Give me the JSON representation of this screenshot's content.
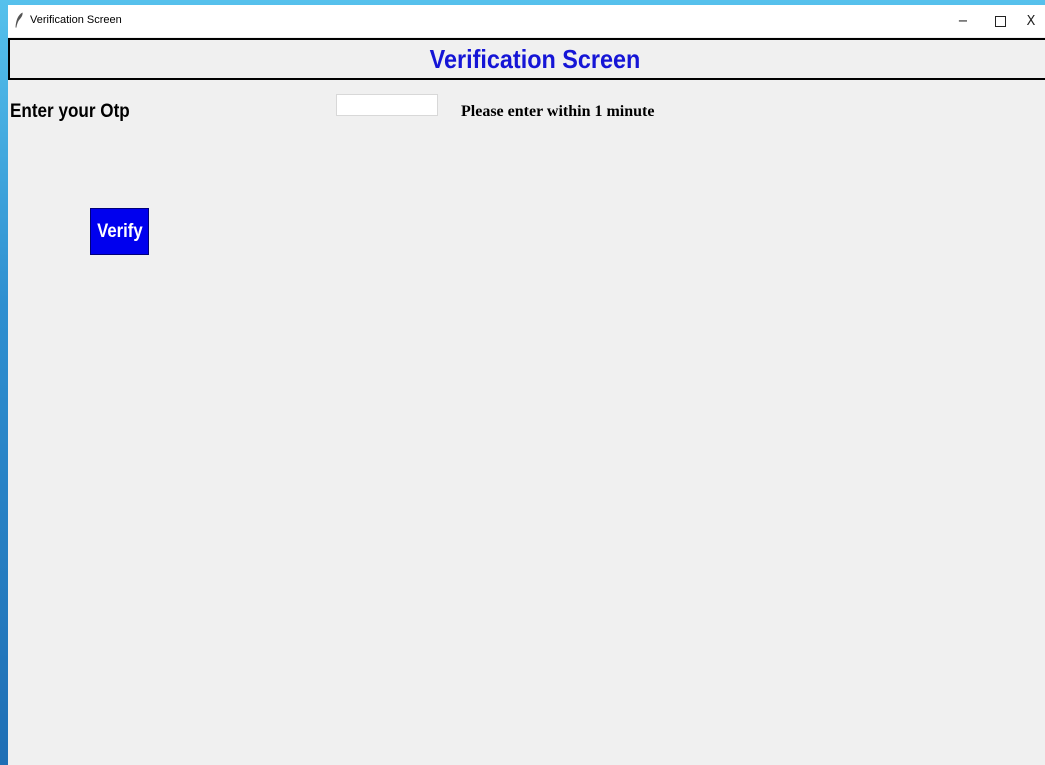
{
  "window": {
    "title": "Verification Screen",
    "icon": "feather-icon",
    "controls": {
      "minimize": "−",
      "maximize": "",
      "close": "X"
    }
  },
  "header": {
    "title": "Verification Screen",
    "title_color": "#1515d6"
  },
  "form": {
    "otp_label": "Enter your Otp",
    "otp_value": "",
    "hint": "Please enter within 1 minute"
  },
  "actions": {
    "verify_label": "Verify",
    "verify_color": "#0000ee"
  }
}
